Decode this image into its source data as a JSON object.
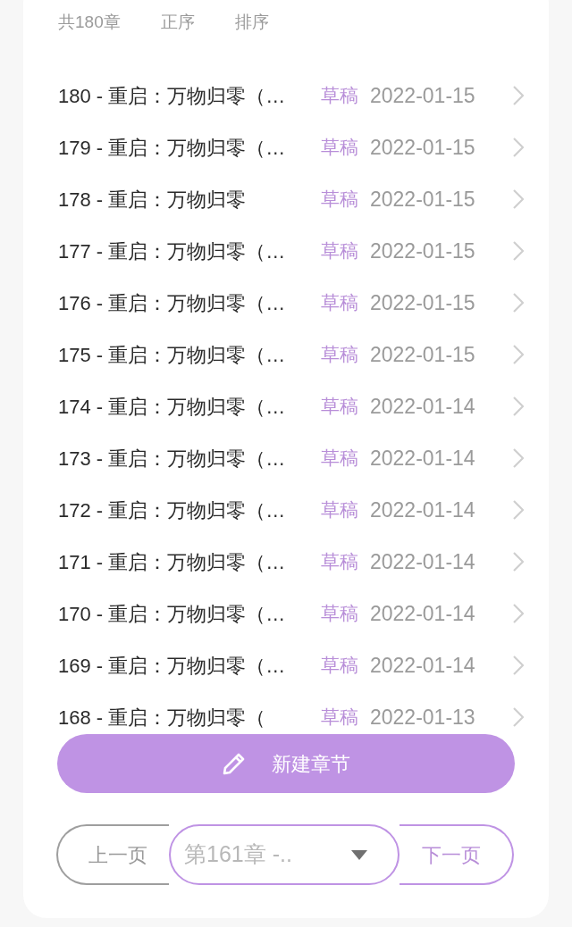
{
  "header": {
    "count": "共180章",
    "order": "正序",
    "sort": "排序"
  },
  "chapters": [
    {
      "title": "180 - 重启：万物归零（…",
      "status": "草稿",
      "date": "2022-01-15"
    },
    {
      "title": "179 - 重启：万物归零（…",
      "status": "草稿",
      "date": "2022-01-15"
    },
    {
      "title": "178 - 重启：万物归零",
      "status": "草稿",
      "date": "2022-01-15"
    },
    {
      "title": "177 - 重启：万物归零（…",
      "status": "草稿",
      "date": "2022-01-15"
    },
    {
      "title": "176 - 重启：万物归零（…",
      "status": "草稿",
      "date": "2022-01-15"
    },
    {
      "title": "175 - 重启：万物归零（…",
      "status": "草稿",
      "date": "2022-01-15"
    },
    {
      "title": "174 - 重启：万物归零（…",
      "status": "草稿",
      "date": "2022-01-14"
    },
    {
      "title": "173 - 重启：万物归零（…",
      "status": "草稿",
      "date": "2022-01-14"
    },
    {
      "title": "172 - 重启：万物归零（…",
      "status": "草稿",
      "date": "2022-01-14"
    },
    {
      "title": "171 - 重启：万物归零（…",
      "status": "草稿",
      "date": "2022-01-14"
    },
    {
      "title": "170 - 重启：万物归零（…",
      "status": "草稿",
      "date": "2022-01-14"
    },
    {
      "title": "169 - 重启：万物归零（…",
      "status": "草稿",
      "date": "2022-01-14"
    },
    {
      "title": "168 - 重启：万物归零（",
      "status": "草稿",
      "date": "2022-01-13"
    }
  ],
  "new_chapter_button": "新建章节",
  "pager": {
    "prev": {
      "label": "上一页",
      "disabled": true
    },
    "select": "第161章 -..",
    "next": {
      "label": "下一页",
      "disabled": false
    }
  }
}
